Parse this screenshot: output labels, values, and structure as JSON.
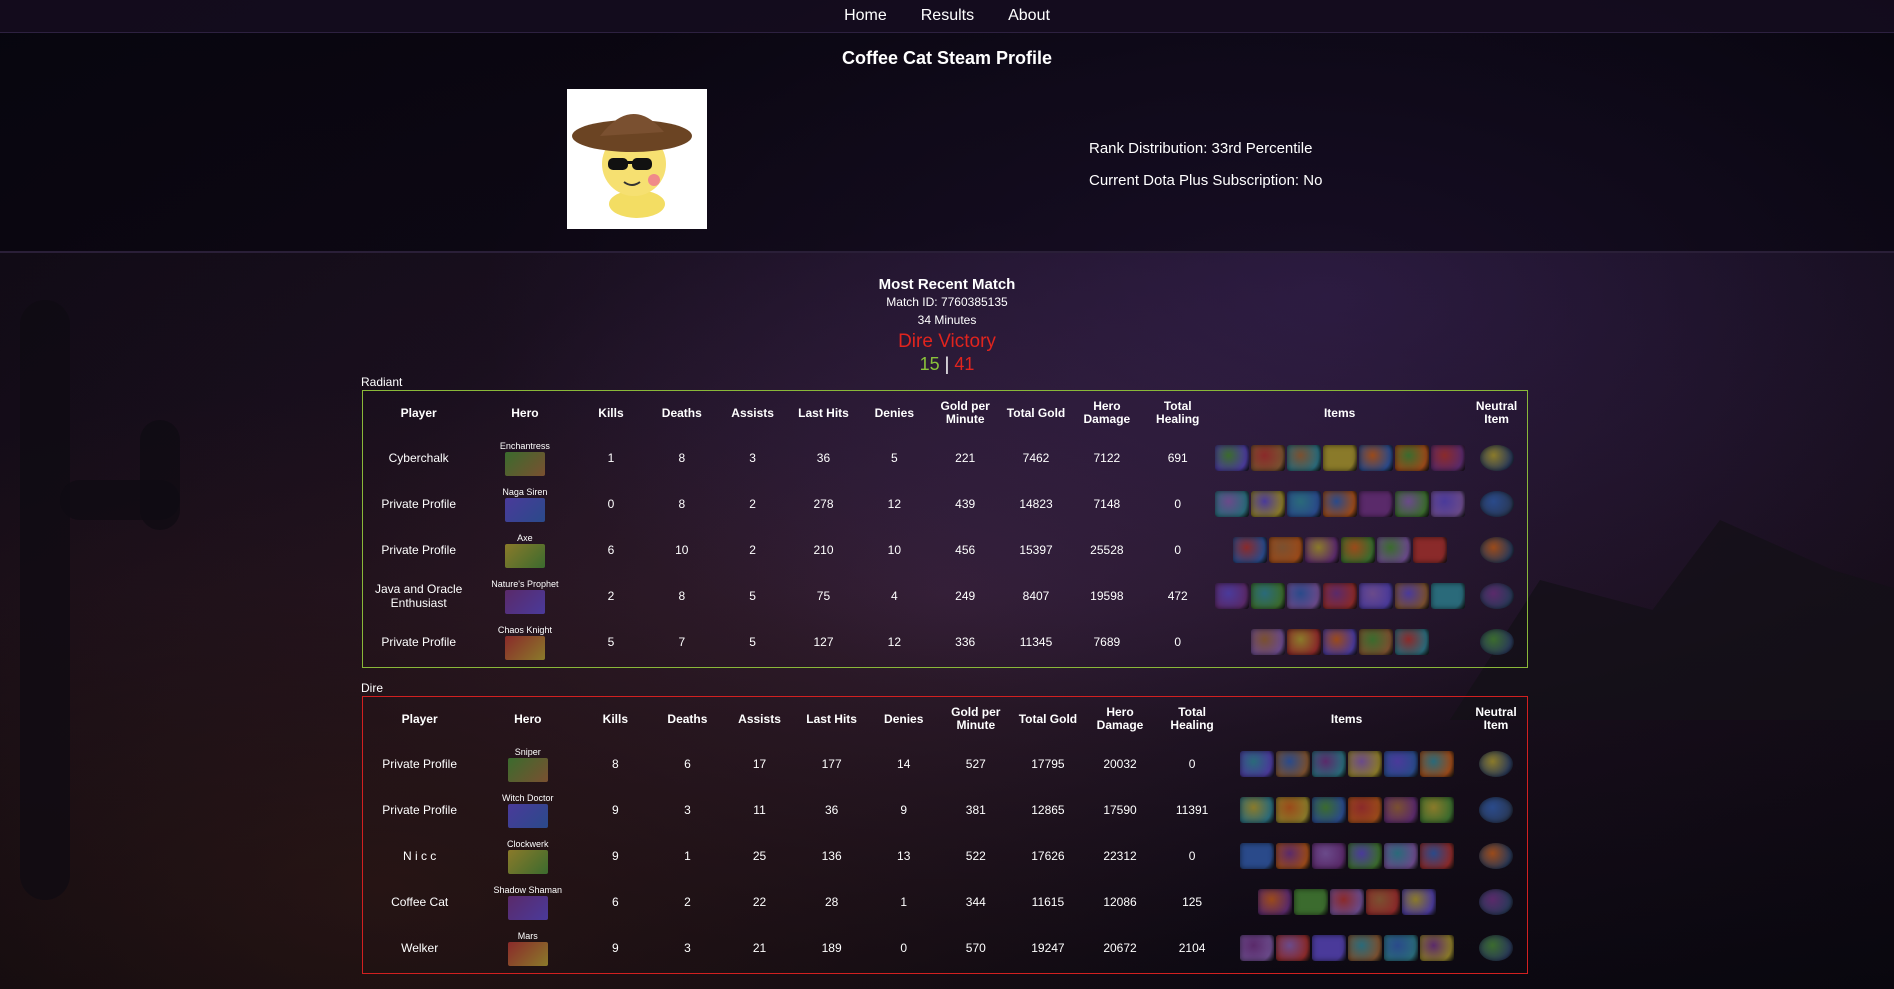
{
  "nav": {
    "items": [
      "Home",
      "Results",
      "About"
    ]
  },
  "profile": {
    "title": "Coffee Cat Steam Profile",
    "rank_distribution": "Rank Distribution: 33rd Percentile",
    "dota_plus": "Current Dota Plus Subscription: No"
  },
  "match": {
    "heading": "Most Recent Match",
    "match_id": "Match ID: 7760385135",
    "duration": "34 Minutes",
    "result": "Dire Victory",
    "radiant_score": "15",
    "separator": "|",
    "dire_score": "41"
  },
  "columns": [
    "Player",
    "Hero",
    "Kills",
    "Deaths",
    "Assists",
    "Last Hits",
    "Denies",
    "Gold per Minute",
    "Total Gold",
    "Hero Damage",
    "Total Healing",
    "Items",
    "Neutral Item"
  ],
  "radiant": {
    "label": "Radiant",
    "color": "#8ab839",
    "players": [
      {
        "player": "Cyberchalk",
        "hero": "Enchantress",
        "kills": "1",
        "deaths": "8",
        "assists": "3",
        "last_hits": "36",
        "denies": "5",
        "gpm": "221",
        "total_gold": "7462",
        "hero_damage": "7122",
        "healing": "691"
      },
      {
        "player": "Private Profile",
        "hero": "Naga Siren",
        "kills": "0",
        "deaths": "8",
        "assists": "2",
        "last_hits": "278",
        "denies": "12",
        "gpm": "439",
        "total_gold": "14823",
        "hero_damage": "7148",
        "healing": "0"
      },
      {
        "player": "Private Profile",
        "hero": "Axe",
        "kills": "6",
        "deaths": "10",
        "assists": "2",
        "last_hits": "210",
        "denies": "10",
        "gpm": "456",
        "total_gold": "15397",
        "hero_damage": "25528",
        "healing": "0"
      },
      {
        "player": "Java and Oracle Enthusiast",
        "hero": "Nature's Prophet",
        "kills": "2",
        "deaths": "8",
        "assists": "5",
        "last_hits": "75",
        "denies": "4",
        "gpm": "249",
        "total_gold": "8407",
        "hero_damage": "19598",
        "healing": "472"
      },
      {
        "player": "Private Profile",
        "hero": "Chaos Knight",
        "kills": "5",
        "deaths": "7",
        "assists": "5",
        "last_hits": "127",
        "denies": "12",
        "gpm": "336",
        "total_gold": "11345",
        "hero_damage": "7689",
        "healing": "0"
      }
    ]
  },
  "dire": {
    "label": "Dire",
    "color": "#d22020",
    "players": [
      {
        "player": "Private Profile",
        "hero": "Sniper",
        "kills": "8",
        "deaths": "6",
        "assists": "17",
        "last_hits": "177",
        "denies": "14",
        "gpm": "527",
        "total_gold": "17795",
        "hero_damage": "20032",
        "healing": "0"
      },
      {
        "player": "Private Profile",
        "hero": "Witch Doctor",
        "kills": "9",
        "deaths": "3",
        "assists": "11",
        "last_hits": "36",
        "denies": "9",
        "gpm": "381",
        "total_gold": "12865",
        "hero_damage": "17590",
        "healing": "11391"
      },
      {
        "player": "N i c c",
        "hero": "Clockwerk",
        "kills": "9",
        "deaths": "1",
        "assists": "25",
        "last_hits": "136",
        "denies": "13",
        "gpm": "522",
        "total_gold": "17626",
        "hero_damage": "22312",
        "healing": "0"
      },
      {
        "player": "Coffee Cat",
        "hero": "Shadow Shaman",
        "kills": "6",
        "deaths": "2",
        "assists": "22",
        "last_hits": "28",
        "denies": "1",
        "gpm": "344",
        "total_gold": "11615",
        "hero_damage": "12086",
        "healing": "125"
      },
      {
        "player": "Welker",
        "hero": "Mars",
        "kills": "9",
        "deaths": "3",
        "assists": "21",
        "last_hits": "189",
        "denies": "0",
        "gpm": "570",
        "total_gold": "19247",
        "hero_damage": "20672",
        "healing": "2104"
      }
    ]
  }
}
